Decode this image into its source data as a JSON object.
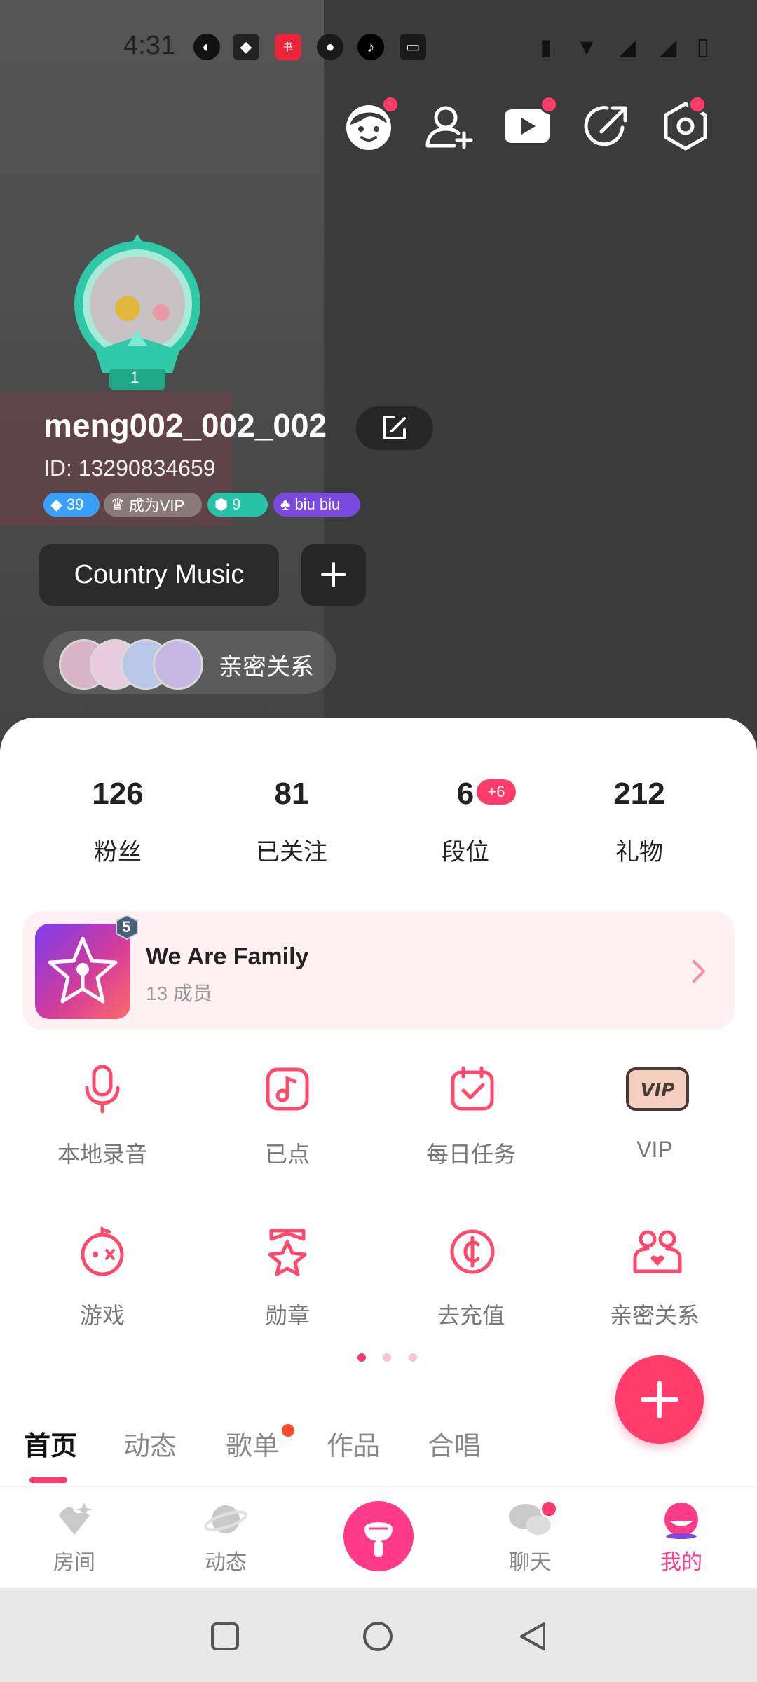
{
  "status_bar": {
    "time": "4:31"
  },
  "profile": {
    "username": "meng002_002_002",
    "id_text": "ID: 13290834659",
    "avatar_level": "1",
    "badges": [
      {
        "label": "39",
        "color": "#3aa0ff"
      },
      {
        "label": "成为VIP",
        "color": "#8a7a7a"
      },
      {
        "label": "9",
        "color": "#27c3a6"
      },
      {
        "label": "biu biu",
        "color": "#7a49e0"
      }
    ],
    "tag": "Country Music",
    "intimate_label": "亲密关系"
  },
  "stats": [
    {
      "value": "126",
      "label": "粉丝"
    },
    {
      "value": "81",
      "label": "已关注"
    },
    {
      "value": "6",
      "label": "段位",
      "extra": "+6"
    },
    {
      "value": "212",
      "label": "礼物"
    }
  ],
  "family": {
    "title": "We Are Family",
    "members": "13 成员",
    "level": "5"
  },
  "features": [
    {
      "label": "本地录音",
      "icon": "microphone-icon"
    },
    {
      "label": "已点",
      "icon": "music-note-icon"
    },
    {
      "label": "每日任务",
      "icon": "calendar-check-icon"
    },
    {
      "label": "VIP",
      "icon": "vip-icon"
    },
    {
      "label": "游戏",
      "icon": "game-icon"
    },
    {
      "label": "勋章",
      "icon": "medal-icon"
    },
    {
      "label": "去充值",
      "icon": "recharge-icon"
    },
    {
      "label": "亲密关系",
      "icon": "intimate-icon"
    }
  ],
  "content_tabs": [
    "首页",
    "动态",
    "歌单",
    "作品",
    "合唱"
  ],
  "bottom_nav": [
    {
      "label": "房间",
      "icon": "room-icon"
    },
    {
      "label": "动态",
      "icon": "planet-icon"
    },
    {
      "label": "聊天",
      "icon": "chat-icon"
    },
    {
      "label": "我的",
      "icon": "me-icon"
    }
  ],
  "colors": {
    "accent": "#ff3b6b",
    "panel": "#ffffff",
    "header": "#3b3b3b"
  }
}
